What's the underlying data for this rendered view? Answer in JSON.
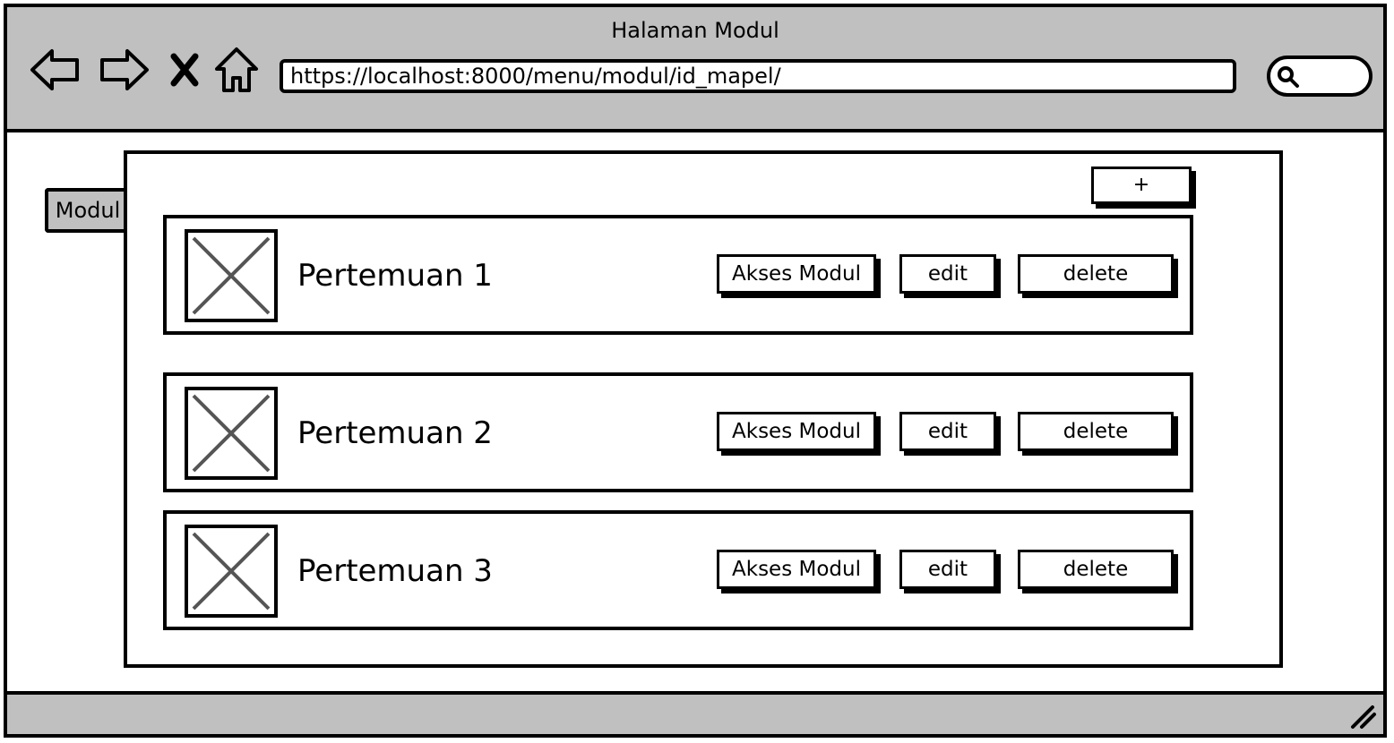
{
  "window": {
    "title": "Halaman Modul"
  },
  "toolbar": {
    "back_icon": "back-arrow-icon",
    "forward_icon": "forward-arrow-icon",
    "stop_icon": "close-x-icon",
    "home_icon": "home-icon",
    "url": "https://localhost:8000/menu/modul/id_mapel/",
    "search_icon": "search-icon"
  },
  "sidebar": {
    "tab_label": "Modul"
  },
  "main": {
    "add_label": "+",
    "cards": [
      {
        "title": "Pertemuan 1",
        "akses_label": "Akses Modul",
        "edit_label": "edit",
        "delete_label": "delete"
      },
      {
        "title": "Pertemuan 2",
        "akses_label": "Akses Modul",
        "edit_label": "edit",
        "delete_label": "delete"
      },
      {
        "title": "Pertemuan 3",
        "akses_label": "Akses Modul",
        "edit_label": "edit",
        "delete_label": "delete"
      }
    ]
  },
  "colors": {
    "chrome": "#c0c0c0",
    "border": "#000000",
    "background": "#ffffff",
    "placeholder_stroke": "#555555"
  }
}
